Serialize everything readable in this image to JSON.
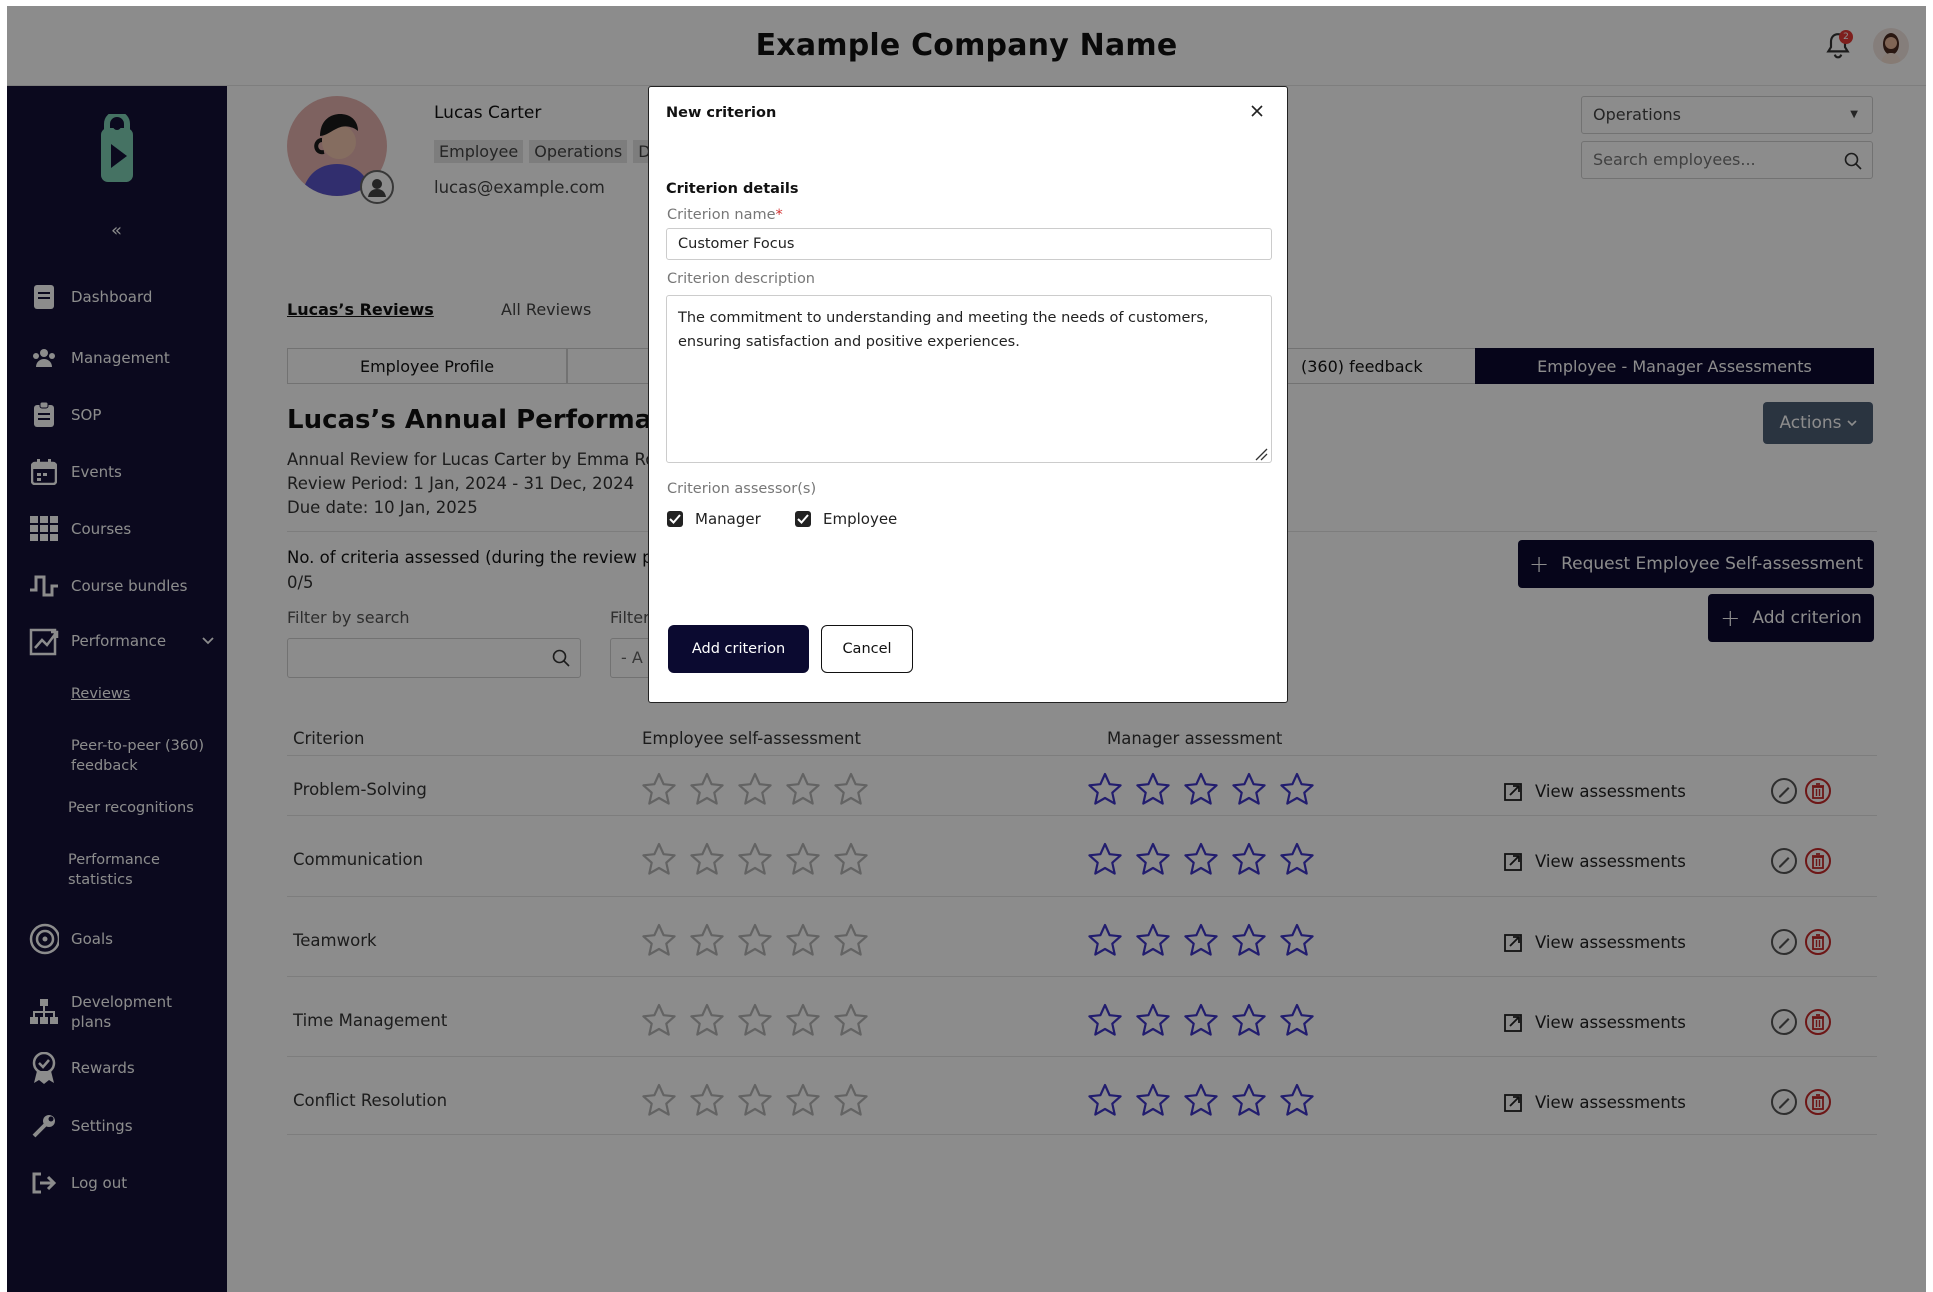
{
  "header": {
    "company_name": "Example Company Name",
    "notification_count": "2"
  },
  "sidebar": {
    "collapse_label": "«",
    "items": [
      {
        "label": "Dashboard",
        "icon": "dashboard-icon"
      },
      {
        "label": "Management",
        "icon": "people-icon"
      },
      {
        "label": "SOP",
        "icon": "clipboard-icon"
      },
      {
        "label": "Events",
        "icon": "calendar-icon"
      },
      {
        "label": "Courses",
        "icon": "grid-icon"
      },
      {
        "label": "Course bundles",
        "icon": "bundle-icon"
      },
      {
        "label": "Performance",
        "icon": "chart-icon"
      },
      {
        "label": "Goals",
        "icon": "target-icon"
      },
      {
        "label": "Development plans",
        "icon": "hierarchy-icon"
      },
      {
        "label": "Rewards",
        "icon": "badge-icon"
      },
      {
        "label": "Settings",
        "icon": "wrench-icon"
      },
      {
        "label": "Log out",
        "icon": "logout-icon"
      }
    ],
    "performance_sub": [
      {
        "label": "Reviews"
      },
      {
        "label": "Peer-to-peer (360) feedback"
      },
      {
        "label": "Peer recognitions"
      },
      {
        "label": "Performance statistics"
      }
    ]
  },
  "profile": {
    "name": "Lucas Carter",
    "tags": [
      "Employee",
      "Operations",
      "De"
    ],
    "email": "lucas@example.com"
  },
  "filters": {
    "department": "Operations",
    "search_placeholder": "Search employees..."
  },
  "tabs": {
    "primary": [
      "Lucas’s Reviews",
      "All Reviews"
    ],
    "segments": [
      "Employee Profile",
      "(360) feedback",
      "Employee - Manager Assessments"
    ]
  },
  "review": {
    "title": "Lucas’s Annual Performance",
    "line1": "Annual Review for Lucas Carter by Emma Rob",
    "line2": "Review Period: 1 Jan, 2024 - 31 Dec, 2024",
    "line3": "Due date: 10 Jan, 2025",
    "criteria_label": "No. of criteria assessed (during the review pe",
    "criteria_count": "0/5",
    "filter_search_label": "Filter by search",
    "filter2_label": "Filter",
    "filter2_value": "- A",
    "actions_label": "Actions",
    "request_btn": "Request Employee Self-assessment",
    "add_btn": "Add criterion"
  },
  "table": {
    "headers": [
      "Criterion",
      "Employee self-assessment",
      "Manager assessment"
    ],
    "view_label": "View assessments",
    "rows": [
      {
        "criterion": "Problem-Solving"
      },
      {
        "criterion": "Communication"
      },
      {
        "criterion": "Teamwork"
      },
      {
        "criterion": "Time Management"
      },
      {
        "criterion": "Conflict Resolution"
      }
    ]
  },
  "modal": {
    "title": "New criterion",
    "section": "Criterion details",
    "name_label": "Criterion name",
    "name_required": "*",
    "name_value": "Customer Focus",
    "desc_label": "Criterion description",
    "desc_value": "The commitment to understanding and meeting the needs of customers, ensuring satisfaction and positive experiences.",
    "assessors_label": "Criterion assessor(s)",
    "assessors": [
      {
        "label": "Manager",
        "checked": true
      },
      {
        "label": "Employee",
        "checked": true
      }
    ],
    "add_label": "Add criterion",
    "cancel_label": "Cancel"
  },
  "colors": {
    "sidebar_bg": "#141238",
    "primary_dark": "#0b0a30",
    "star_manager": "#3f36c9",
    "star_empty": "#b5b5b5",
    "delete_red": "#c62828",
    "logo_green": "#7fd0b4"
  }
}
